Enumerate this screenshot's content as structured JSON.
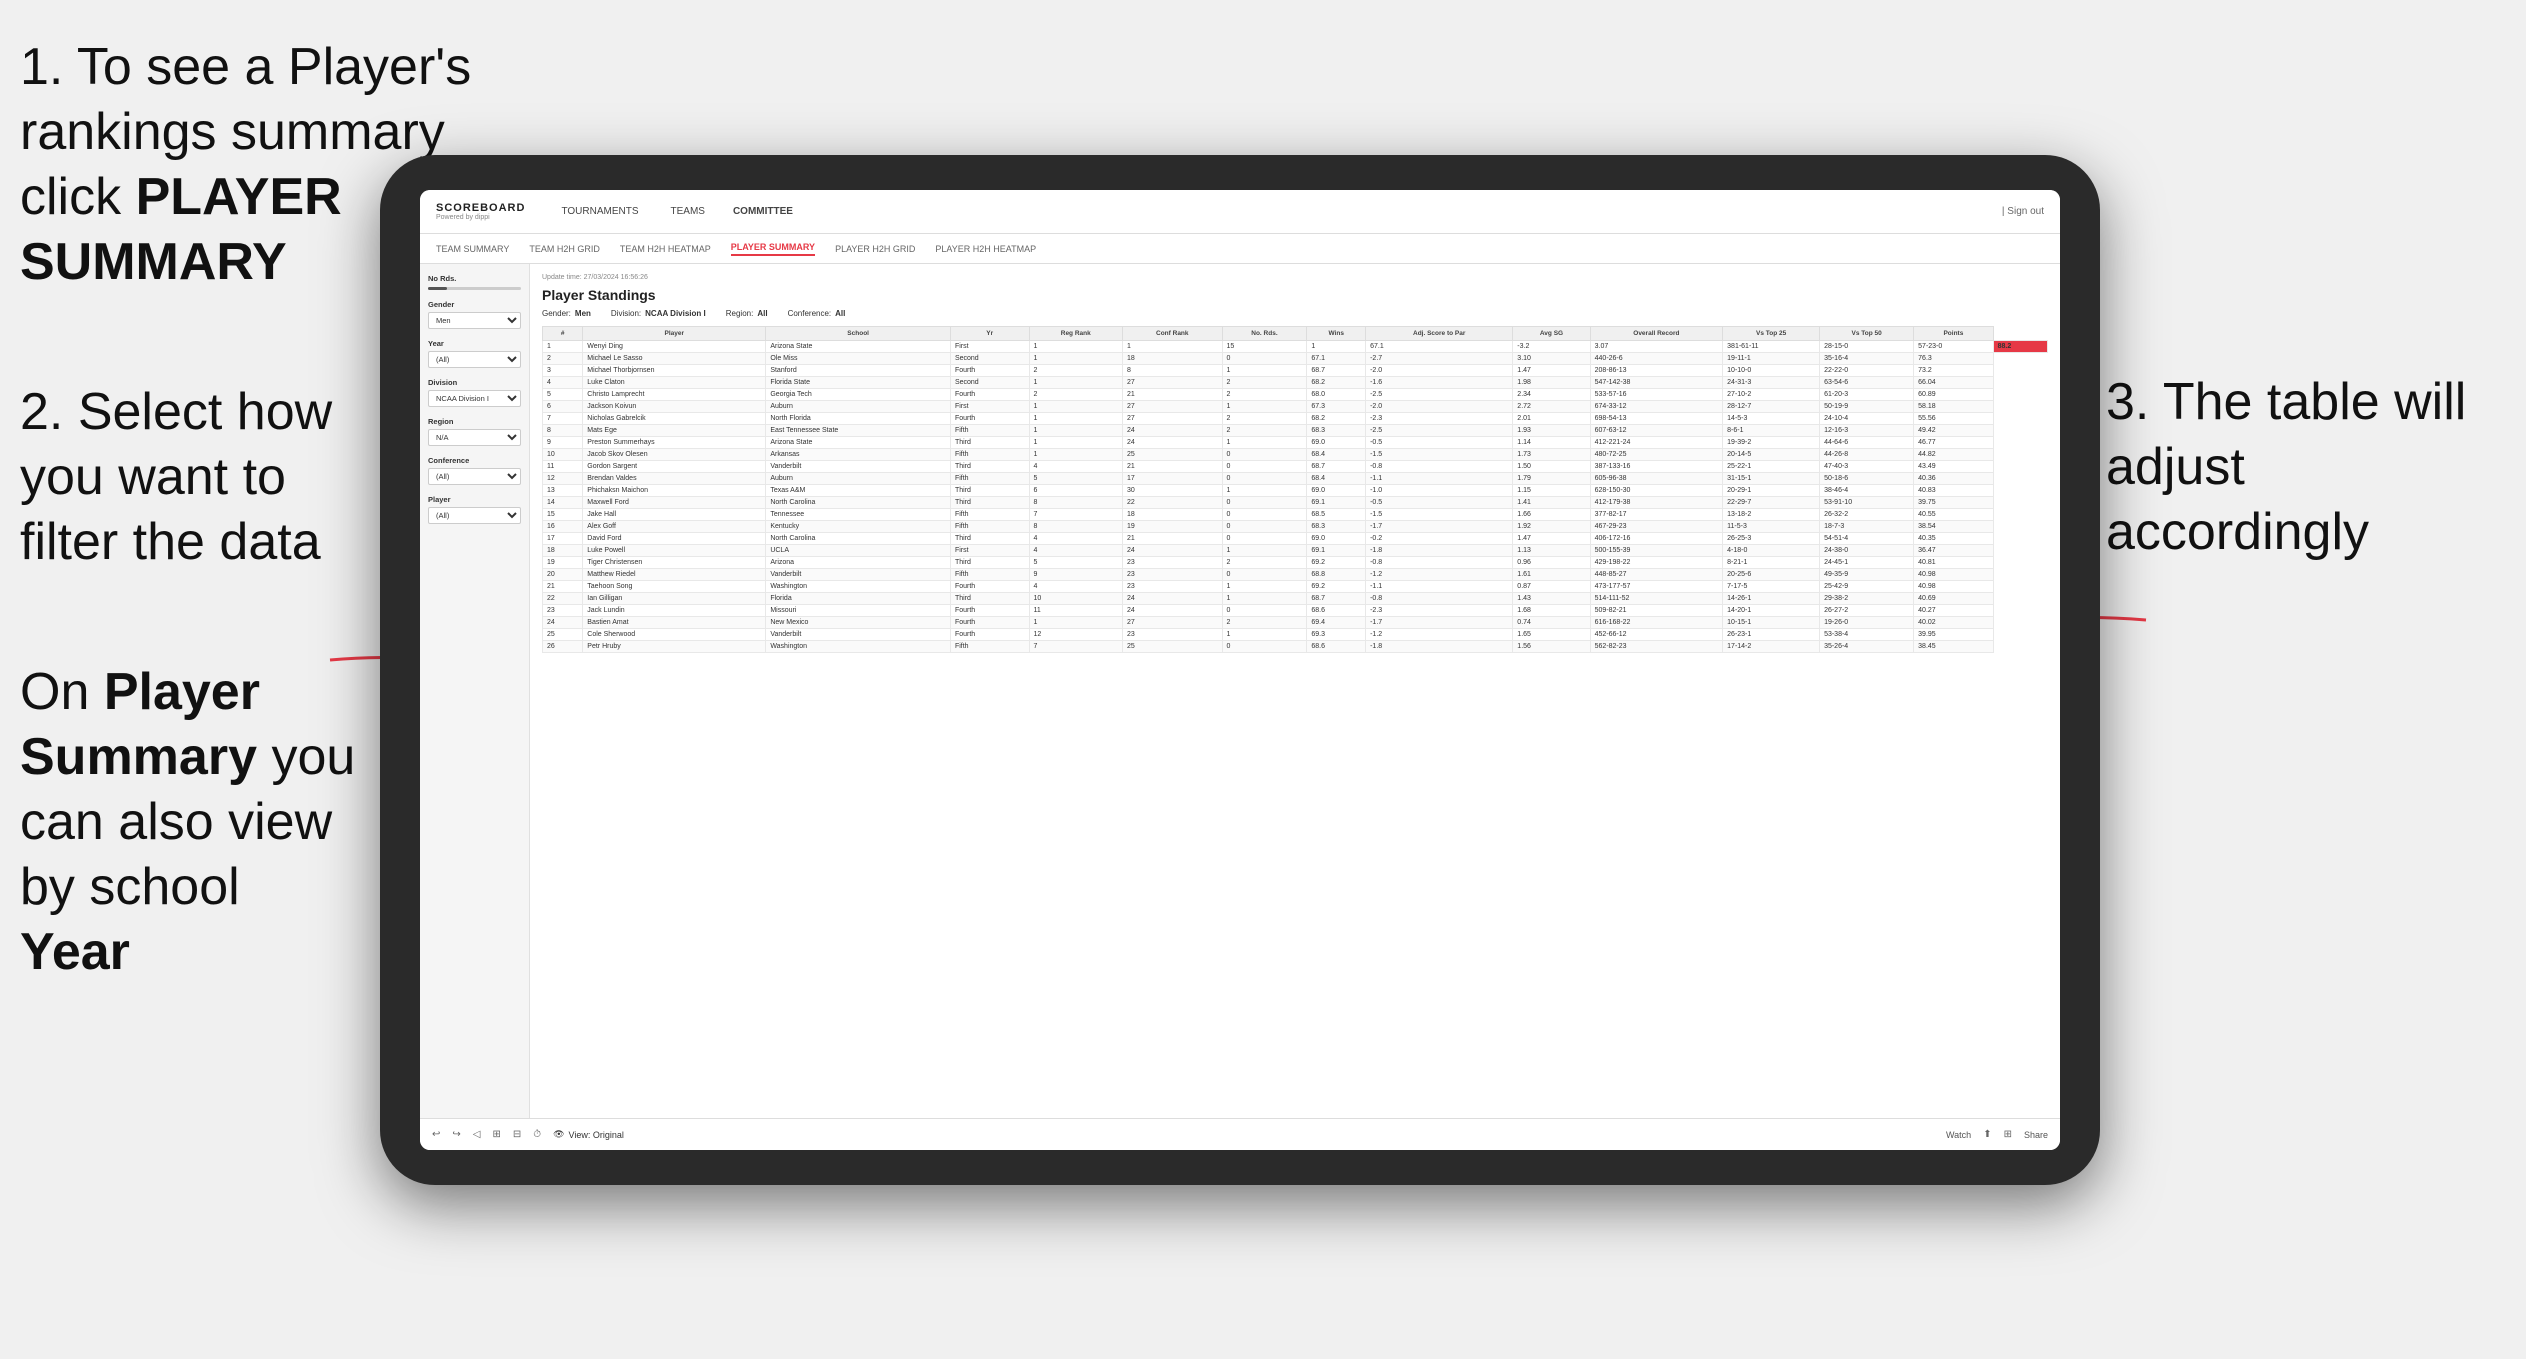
{
  "instructions": {
    "step1": "1. To see a Player's rankings summary click ",
    "step1_bold": "PLAYER SUMMARY",
    "step2_line1": "2. Select how you want to",
    "step2_line2": "filter the data",
    "step3_line1": "3. The table will",
    "step3_line2": "adjust accordingly",
    "step4_line1": "On ",
    "step4_bold1": "Player Summary",
    "step4_line2": " you can also view by school ",
    "step4_bold2": "Year"
  },
  "nav": {
    "logo": "SCOREBOARD",
    "logo_sub": "Powered by dippi",
    "items": [
      "TOURNAMENTS",
      "TEAMS",
      "COMMITTEE"
    ],
    "right": "Sign out",
    "sign_in_icon": "|"
  },
  "sub_nav": {
    "items": [
      "TEAM SUMMARY",
      "TEAM H2H GRID",
      "TEAM H2H HEATMAP",
      "PLAYER SUMMARY",
      "PLAYER H2H GRID",
      "PLAYER H2H HEATMAP"
    ],
    "active": "PLAYER SUMMARY"
  },
  "sidebar": {
    "no_rds_label": "No Rds.",
    "gender_label": "Gender",
    "gender_value": "Men",
    "year_label": "Year",
    "year_value": "(All)",
    "division_label": "Division",
    "division_value": "NCAA Division I",
    "region_label": "Region",
    "region_value": "N/A",
    "conference_label": "Conference",
    "conference_value": "(All)",
    "player_label": "Player",
    "player_value": "(All)"
  },
  "table": {
    "title": "Player Standings",
    "update_time": "Update time:",
    "update_date": "27/03/2024 16:56:26",
    "gender_label": "Gender:",
    "gender_value": "Men",
    "division_label": "Division:",
    "division_value": "NCAA Division I",
    "region_label": "Region:",
    "region_value": "All",
    "conference_label": "Conference:",
    "conference_value": "All",
    "columns": [
      "#",
      "Player",
      "School",
      "Yr",
      "Reg Rank",
      "Conf Rank",
      "No. Rds.",
      "Wins",
      "Adj. Score to Par",
      "Avg SG",
      "Overall Record",
      "Vs Top 25",
      "Vs Top 50",
      "Points"
    ],
    "rows": [
      [
        "1",
        "Wenyi Ding",
        "Arizona State",
        "First",
        "1",
        "1",
        "15",
        "1",
        "67.1",
        "-3.2",
        "3.07",
        "381-61-11",
        "28-15-0",
        "57-23-0",
        "88.2"
      ],
      [
        "2",
        "Michael Le Sasso",
        "Ole Miss",
        "Second",
        "1",
        "18",
        "0",
        "67.1",
        "-2.7",
        "3.10",
        "440-26-6",
        "19-11-1",
        "35-16-4",
        "76.3"
      ],
      [
        "3",
        "Michael Thorbjornsen",
        "Stanford",
        "Fourth",
        "2",
        "8",
        "1",
        "68.7",
        "-2.0",
        "1.47",
        "208-86-13",
        "10-10-0",
        "22-22-0",
        "73.2"
      ],
      [
        "4",
        "Luke Claton",
        "Florida State",
        "Second",
        "1",
        "27",
        "2",
        "68.2",
        "-1.6",
        "1.98",
        "547-142-38",
        "24-31-3",
        "63-54-6",
        "66.04"
      ],
      [
        "5",
        "Christo Lamprecht",
        "Georgia Tech",
        "Fourth",
        "2",
        "21",
        "2",
        "68.0",
        "-2.5",
        "2.34",
        "533-57-16",
        "27-10-2",
        "61-20-3",
        "60.89"
      ],
      [
        "6",
        "Jackson Koivun",
        "Auburn",
        "First",
        "1",
        "27",
        "1",
        "67.3",
        "-2.0",
        "2.72",
        "674-33-12",
        "28-12-7",
        "50-19-9",
        "58.18"
      ],
      [
        "7",
        "Nicholas Gabrelcik",
        "North Florida",
        "Fourth",
        "1",
        "27",
        "2",
        "68.2",
        "-2.3",
        "2.01",
        "698-54-13",
        "14-5-3",
        "24-10-4",
        "55.56"
      ],
      [
        "8",
        "Mats Ege",
        "East Tennessee State",
        "Fifth",
        "1",
        "24",
        "2",
        "68.3",
        "-2.5",
        "1.93",
        "607-63-12",
        "8-6-1",
        "12-16-3",
        "49.42"
      ],
      [
        "9",
        "Preston Summerhays",
        "Arizona State",
        "Third",
        "1",
        "24",
        "1",
        "69.0",
        "-0.5",
        "1.14",
        "412-221-24",
        "19-39-2",
        "44-64-6",
        "46.77"
      ],
      [
        "10",
        "Jacob Skov Olesen",
        "Arkansas",
        "Fifth",
        "1",
        "25",
        "0",
        "68.4",
        "-1.5",
        "1.73",
        "480-72-25",
        "20-14-5",
        "44-26-8",
        "44.82"
      ],
      [
        "11",
        "Gordon Sargent",
        "Vanderbilt",
        "Third",
        "4",
        "21",
        "0",
        "68.7",
        "-0.8",
        "1.50",
        "387-133-16",
        "25-22-1",
        "47-40-3",
        "43.49"
      ],
      [
        "12",
        "Brendan Valdes",
        "Auburn",
        "Fifth",
        "5",
        "17",
        "0",
        "68.4",
        "-1.1",
        "1.79",
        "605-96-38",
        "31-15-1",
        "50-18-6",
        "40.36"
      ],
      [
        "13",
        "Phichaksn Maichon",
        "Texas A&M",
        "Third",
        "6",
        "30",
        "1",
        "69.0",
        "-1.0",
        "1.15",
        "628-150-30",
        "20-29-1",
        "38-46-4",
        "40.83"
      ],
      [
        "14",
        "Maxwell Ford",
        "North Carolina",
        "Third",
        "8",
        "22",
        "0",
        "69.1",
        "-0.5",
        "1.41",
        "412-179-38",
        "22-29-7",
        "53-91-10",
        "39.75"
      ],
      [
        "15",
        "Jake Hall",
        "Tennessee",
        "Fifth",
        "7",
        "18",
        "0",
        "68.5",
        "-1.5",
        "1.66",
        "377-82-17",
        "13-18-2",
        "26-32-2",
        "40.55"
      ],
      [
        "16",
        "Alex Goff",
        "Kentucky",
        "Fifth",
        "8",
        "19",
        "0",
        "68.3",
        "-1.7",
        "1.92",
        "467-29-23",
        "11-5-3",
        "18-7-3",
        "38.54"
      ],
      [
        "17",
        "David Ford",
        "North Carolina",
        "Third",
        "4",
        "21",
        "0",
        "69.0",
        "-0.2",
        "1.47",
        "406-172-16",
        "26-25-3",
        "54-51-4",
        "40.35"
      ],
      [
        "18",
        "Luke Powell",
        "UCLA",
        "First",
        "4",
        "24",
        "1",
        "69.1",
        "-1.8",
        "1.13",
        "500-155-39",
        "4-18-0",
        "24-38-0",
        "36.47"
      ],
      [
        "19",
        "Tiger Christensen",
        "Arizona",
        "Third",
        "5",
        "23",
        "2",
        "69.2",
        "-0.8",
        "0.96",
        "429-198-22",
        "8-21-1",
        "24-45-1",
        "40.81"
      ],
      [
        "20",
        "Matthew Riedel",
        "Vanderbilt",
        "Fifth",
        "9",
        "23",
        "0",
        "68.8",
        "-1.2",
        "1.61",
        "448-85-27",
        "20-25-6",
        "49-35-9",
        "40.98"
      ],
      [
        "21",
        "Taehoon Song",
        "Washington",
        "Fourth",
        "4",
        "23",
        "1",
        "69.2",
        "-1.1",
        "0.87",
        "473-177-57",
        "7-17-5",
        "25-42-9",
        "40.98"
      ],
      [
        "22",
        "Ian Gilligan",
        "Florida",
        "Third",
        "10",
        "24",
        "1",
        "68.7",
        "-0.8",
        "1.43",
        "514-111-52",
        "14-26-1",
        "29-38-2",
        "40.69"
      ],
      [
        "23",
        "Jack Lundin",
        "Missouri",
        "Fourth",
        "11",
        "24",
        "0",
        "68.6",
        "-2.3",
        "1.68",
        "509-82-21",
        "14-20-1",
        "26-27-2",
        "40.27"
      ],
      [
        "24",
        "Bastien Amat",
        "New Mexico",
        "Fourth",
        "1",
        "27",
        "2",
        "69.4",
        "-1.7",
        "0.74",
        "616-168-22",
        "10-15-1",
        "19-26-0",
        "40.02"
      ],
      [
        "25",
        "Cole Sherwood",
        "Vanderbilt",
        "Fourth",
        "12",
        "23",
        "1",
        "69.3",
        "-1.2",
        "1.65",
        "452-66-12",
        "26-23-1",
        "53-38-4",
        "39.95"
      ],
      [
        "26",
        "Petr Hruby",
        "Washington",
        "Fifth",
        "7",
        "25",
        "0",
        "68.6",
        "-1.8",
        "1.56",
        "562-82-23",
        "17-14-2",
        "35-26-4",
        "38.45"
      ]
    ]
  },
  "toolbar": {
    "view_label": "View: Original",
    "watch_label": "Watch",
    "share_label": "Share"
  }
}
